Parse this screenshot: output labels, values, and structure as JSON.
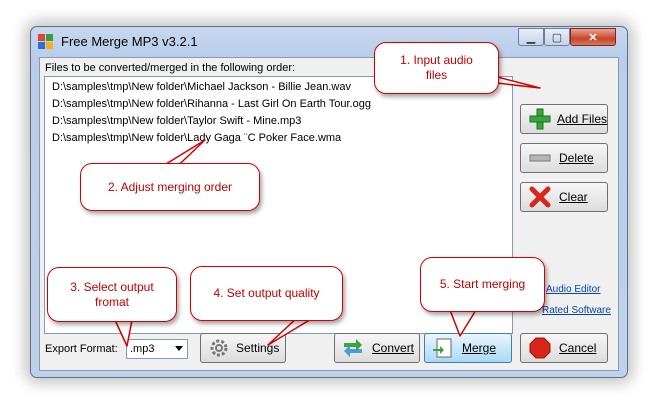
{
  "window": {
    "title": "Free Merge MP3 v3.2.1",
    "controls": [
      "minimize",
      "maximize",
      "close"
    ]
  },
  "file_list": {
    "label": "Files to be converted/merged in the following order:",
    "items": [
      "D:\\samples\\tmp\\New folder\\Michael Jackson - Billie Jean.wav",
      "D:\\samples\\tmp\\New folder\\Rihanna - Last Girl On Earth Tour.ogg",
      "D:\\samples\\tmp\\New folder\\Taylor Swift - Mine.mp3",
      "D:\\samples\\tmp\\New folder\\Lady Gaga ¨C Poker Face.wma"
    ]
  },
  "side_buttons": {
    "add_files": "Add Files",
    "delete": "Delete",
    "clear": "Clear"
  },
  "links": {
    "audio_editor": "Audio Editor",
    "rated_software": "Rated Software"
  },
  "bottom": {
    "export_label": "Export Format:",
    "format_value": ".mp3",
    "settings": "Settings",
    "convert": "Convert",
    "merge": "Merge",
    "cancel": "Cancel"
  },
  "callouts": {
    "input_audio": "1. Input audio\nfiles",
    "adjust_order": "2. Adjust merging order",
    "select_format": "3. Select output\nfromat",
    "output_quality": "4. Set output quality",
    "start_merging": "5. Start merging"
  },
  "colors": {
    "callout_border": "#d40000",
    "callout_text": "#c00000",
    "title_bar": "#b9cde9",
    "close_button": "#c7442b"
  }
}
